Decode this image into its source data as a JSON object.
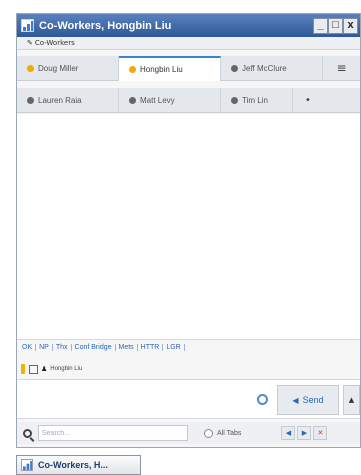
{
  "window": {
    "title": "Co-Workers, Hongbin Liu",
    "subtitle": "Co-Workers",
    "controls": {
      "minimize": "_",
      "maximize": "□",
      "close": "x"
    }
  },
  "tabs": {
    "row1": [
      {
        "label": "Doug Miller",
        "status_color": "#f2a900",
        "active": false
      },
      {
        "label": "Hongbin Liu",
        "status_color": "#f2a900",
        "active": true
      },
      {
        "label": "Jeff McClure",
        "status_color": "#666666",
        "active": false
      }
    ],
    "row2": [
      {
        "label": "Lauren Raia",
        "status_color": "#666666",
        "active": false
      },
      {
        "label": "Matt Levy",
        "status_color": "#666666",
        "active": false
      },
      {
        "label": "Tim Lin",
        "status_color": "#666666",
        "active": false
      }
    ],
    "menu_icon": "hamburger-icon",
    "add_tab_icon": "add-tab-icon"
  },
  "quick_replies": [
    "OK",
    "NP",
    "Thx",
    "Conf Bridge",
    "Mets",
    "HTTR",
    "LGR"
  ],
  "format_bar": {
    "recipient": "Hongbin Liu"
  },
  "send_button": {
    "label": "Send"
  },
  "search": {
    "placeholder": "Search...",
    "scope_label": "All Tabs"
  },
  "taskbar": {
    "label": "Co-Workers, H..."
  },
  "colors": {
    "accent": "#3d82d1",
    "titlebar": "#2d5798",
    "away": "#f2a900",
    "offline": "#666666"
  }
}
